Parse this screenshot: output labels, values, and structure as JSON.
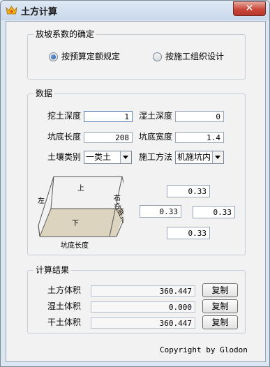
{
  "window": {
    "title": "土方计算",
    "close_label": "✕"
  },
  "slope_group": {
    "title": "放坡系数的确定",
    "options": [
      {
        "label": "按预算定额规定",
        "selected": true
      },
      {
        "label": "按施工组织设计",
        "selected": false
      }
    ]
  },
  "data_group": {
    "title": "数据",
    "excavation_depth": {
      "label": "挖土深度",
      "value": "1"
    },
    "wet_depth": {
      "label": "湿土深度",
      "value": "0"
    },
    "pit_length": {
      "label": "坑底长度",
      "value": "208"
    },
    "pit_width": {
      "label": "坑底宽度",
      "value": "1.4"
    },
    "soil_type": {
      "label": "土壤类别",
      "value": "一类土"
    },
    "construction_method": {
      "label": "施工方法",
      "value": "机施坑内"
    },
    "diagram": {
      "top": "上",
      "left": "左",
      "right": "右",
      "bottom": "下",
      "pit_length": "坑底长度",
      "pit_width": "坑底宽度"
    },
    "slopes": {
      "top": "0.33",
      "left": "0.33",
      "right": "0.33",
      "bottom": "0.33"
    }
  },
  "results_group": {
    "title": "计算结果",
    "rows": [
      {
        "label": "土方体积",
        "value": "360.447",
        "button": "复制"
      },
      {
        "label": "湿土体积",
        "value": "0.000",
        "button": "复制"
      },
      {
        "label": "干土体积",
        "value": "360.447",
        "button": "复制"
      }
    ]
  },
  "footer": {
    "copyright": "Copyright by Glodon"
  }
}
